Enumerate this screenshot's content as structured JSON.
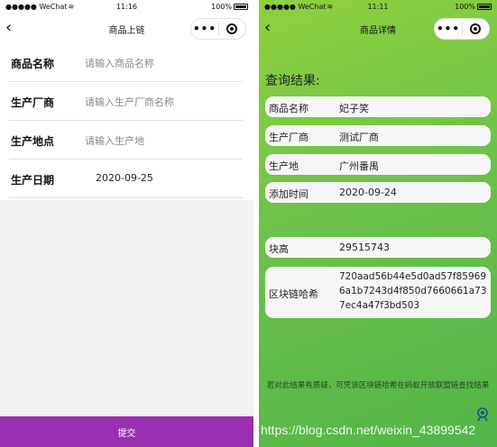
{
  "left": {
    "status": {
      "carrier": "●●●●● WeChat",
      "time": "11:16",
      "battery": "100%"
    },
    "nav": {
      "title": "商品上链",
      "back": "‹",
      "more": "•••"
    },
    "form": [
      {
        "label": "商品名称",
        "placeholder": "请输入商品名称",
        "value": ""
      },
      {
        "label": "生产厂商",
        "placeholder": "请输入生产厂商名称",
        "value": ""
      },
      {
        "label": "生产地点",
        "placeholder": "请输入生产地",
        "value": ""
      },
      {
        "label": "生产日期",
        "placeholder": "",
        "value": "2020-09-25"
      }
    ],
    "submit_label": "提交"
  },
  "right": {
    "status": {
      "carrier": "●●●●● WeChat",
      "time": "11:11",
      "battery": "100%"
    },
    "nav": {
      "title": "商品详情",
      "back": "‹",
      "more": "•••"
    },
    "heading": "查询结果:",
    "fields": [
      {
        "key": "商品名称",
        "value": "妃子笑"
      },
      {
        "key": "生产厂商",
        "value": "测试厂商"
      },
      {
        "key": "生产地",
        "value": "广州番禺"
      },
      {
        "key": "添加时间",
        "value": "2020-09-24"
      }
    ],
    "block_height": {
      "key": "块高",
      "value": "29515743"
    },
    "block_hash": {
      "key": "区块链哈希",
      "value": "720aad56b44e5d0ad57f859696a1b7243d4f850d7660661a737ec4a47f3bd503"
    },
    "footer_note": "若对此结果有质疑，可凭该区块链哈希在蚂蚁开放联盟链查找结果"
  },
  "watermark": "https://blog.csdn.net/weixin_43899542",
  "colors": {
    "submit_bar": "#9b2fb3",
    "result_bg": "#6cc24a",
    "form_bg": "#f1f1f1"
  },
  "icons": [
    "back-chevron-icon",
    "more-dots-icon",
    "target-icon",
    "wifi-icon",
    "battery-icon",
    "lens-icon"
  ]
}
